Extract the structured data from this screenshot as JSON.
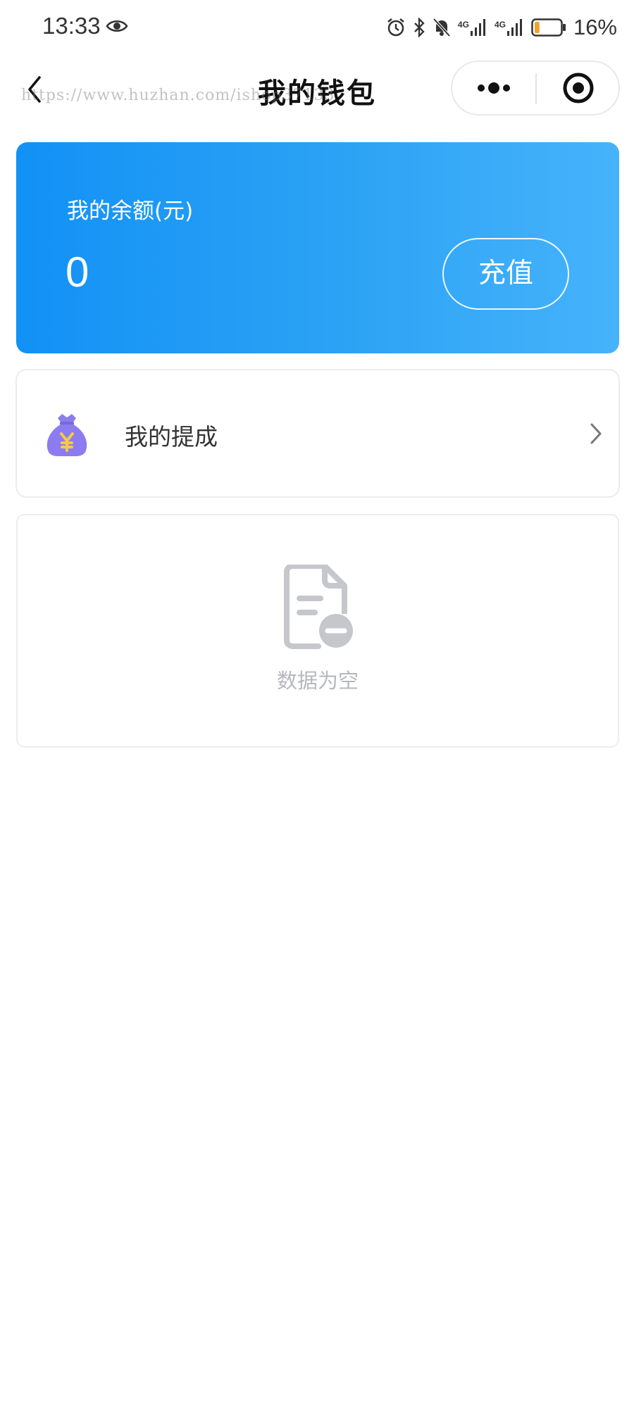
{
  "status_bar": {
    "time": "13:33",
    "battery_percent": "16%",
    "network_1": "4G",
    "network_2": "4G",
    "icons": [
      "eye-icon",
      "alarm-icon",
      "bluetooth-icon",
      "mute-icon",
      "signal-icon",
      "signal-icon",
      "battery-icon"
    ],
    "battery_level": 0.16,
    "battery_color": "#f0a12a"
  },
  "nav": {
    "title": "我的钱包",
    "watermark": "https://www.huzhan.com/ishop37133",
    "back_icon": "chevron-left-icon",
    "more_icon": "more-dots-icon",
    "close_icon": "target-circle-icon"
  },
  "balance": {
    "label": "我的余额(元)",
    "amount": "0",
    "recharge_label": "充值",
    "gradient_colors": [
      "#1291f6",
      "#46b3fb"
    ]
  },
  "commission": {
    "label": "我的提成",
    "icon": "money-bag-icon",
    "icon_colors": {
      "bag": "#8c7cf0",
      "symbol": "#f7c948"
    },
    "arrow_icon": "chevron-right-icon"
  },
  "empty_state": {
    "text": "数据为空",
    "icon": "empty-document-icon",
    "icon_color": "#c5c7cc"
  }
}
